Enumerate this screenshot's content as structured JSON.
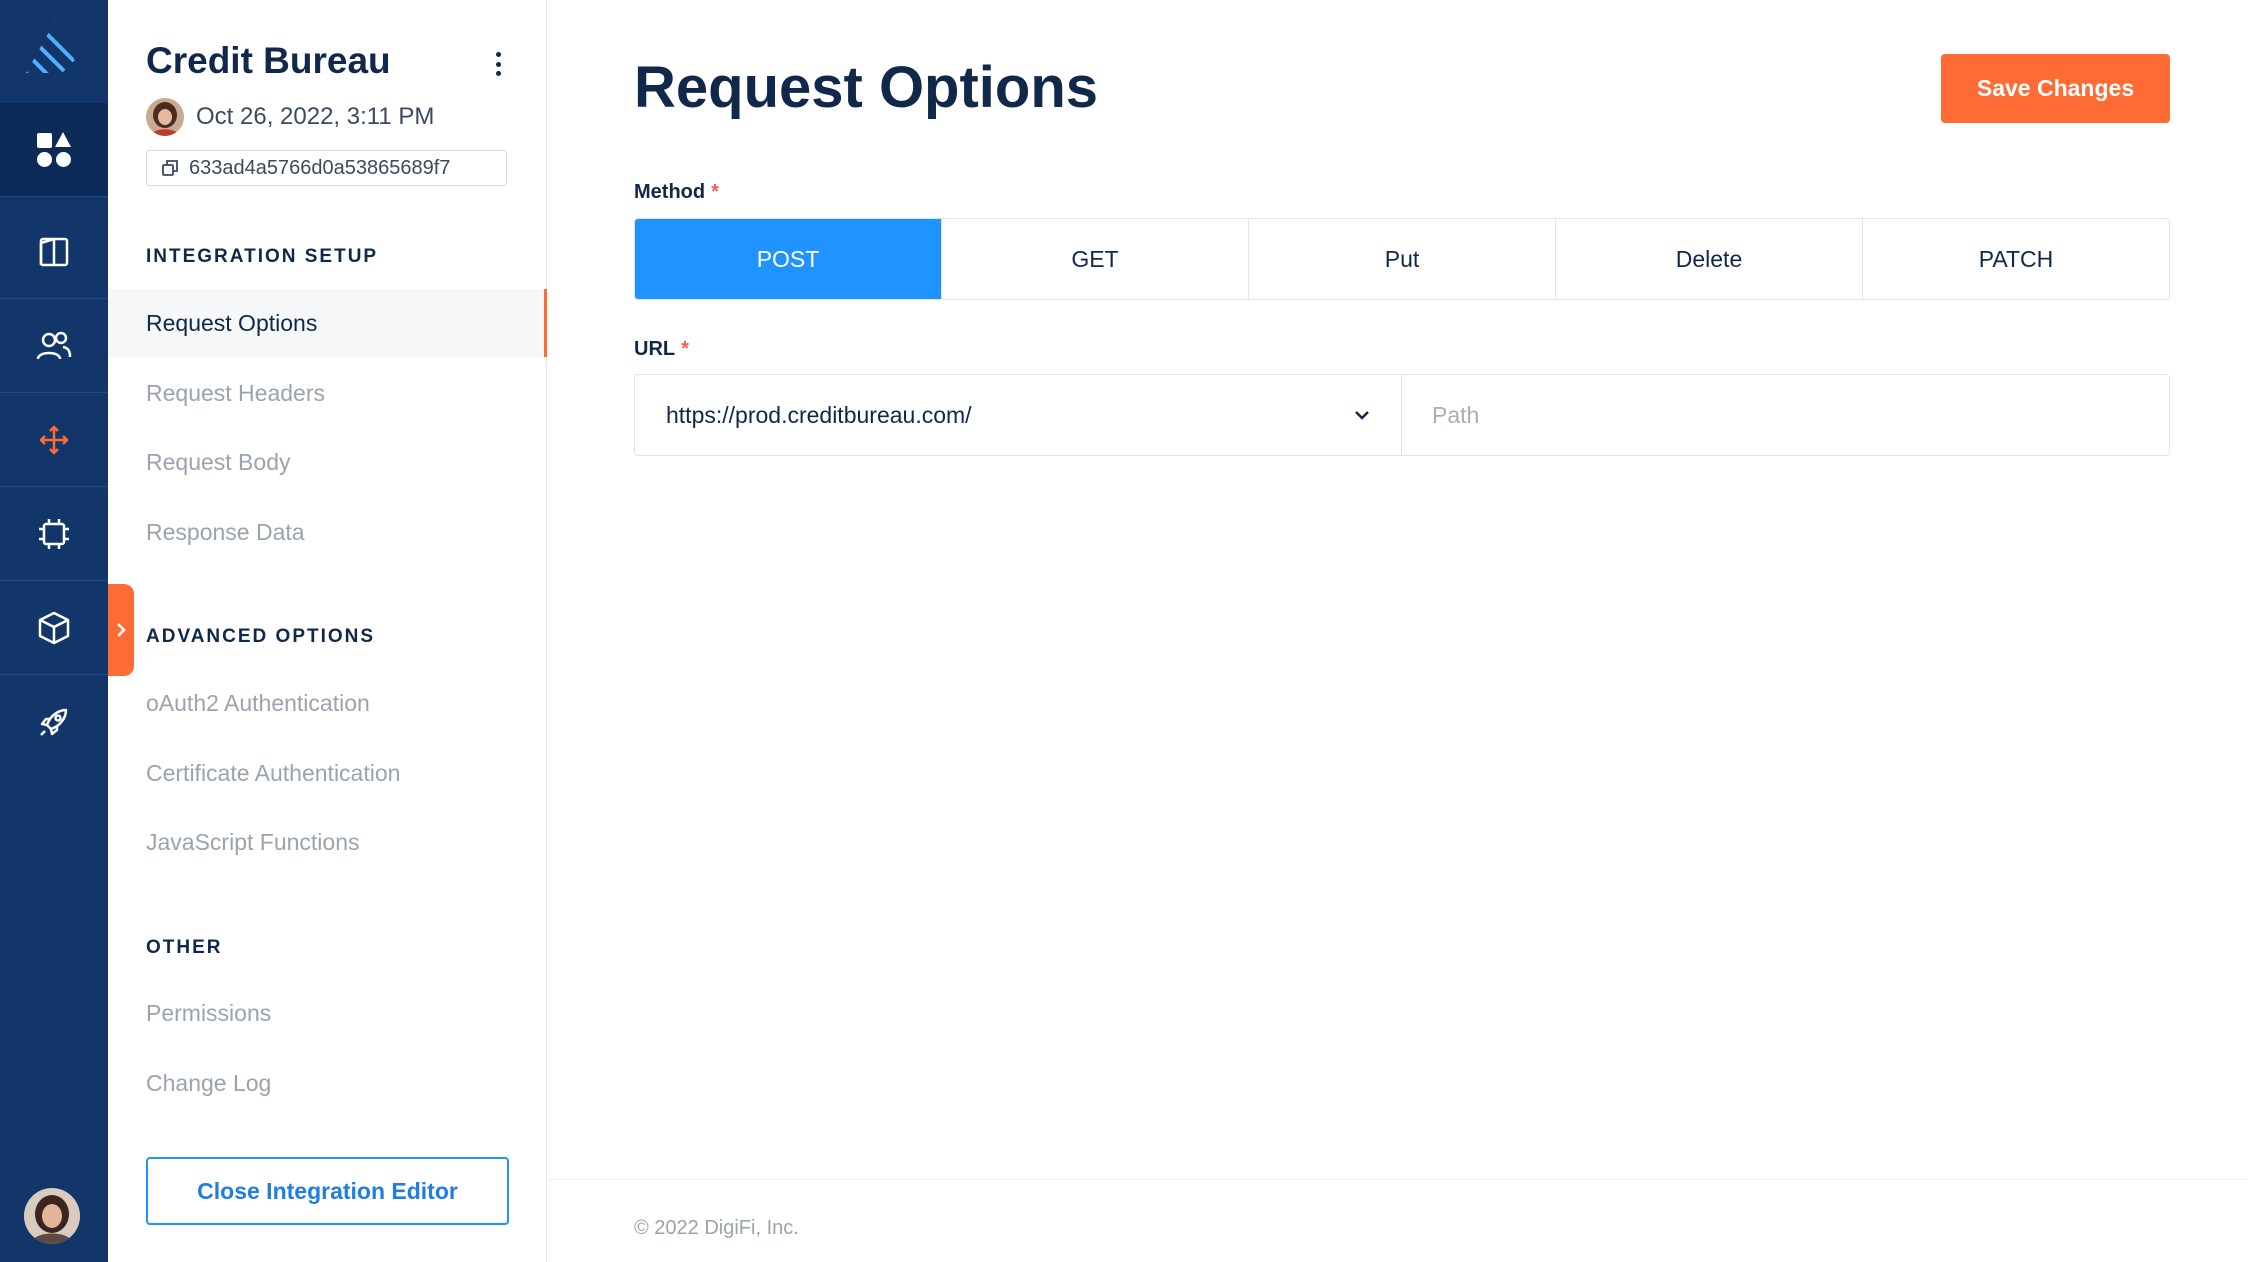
{
  "rail": {
    "items": [
      {
        "name": "apps-icon"
      },
      {
        "name": "book-icon"
      },
      {
        "name": "users-icon"
      },
      {
        "name": "integrations-icon"
      },
      {
        "name": "chip-icon"
      },
      {
        "name": "box-icon"
      },
      {
        "name": "rocket-icon"
      }
    ],
    "accent": "#ff6b35",
    "background": "#12356a"
  },
  "sidebar": {
    "title": "Credit Bureau",
    "date": "Oct 26, 2022, 3:11 PM",
    "id": "633ad4a5766d0a53865689f7",
    "sections": {
      "integration_setup": "INTEGRATION SETUP",
      "advanced_options": "ADVANCED OPTIONS",
      "other": "OTHER"
    },
    "items": {
      "request_options": "Request Options",
      "request_headers": "Request Headers",
      "request_body": "Request Body",
      "response_data": "Response Data",
      "oauth2": "oAuth2 Authentication",
      "certificate": "Certificate Authentication",
      "javascript": "JavaScript Functions",
      "permissions": "Permissions",
      "change_log": "Change Log"
    },
    "close_button": "Close Integration Editor"
  },
  "main": {
    "title": "Request Options",
    "save_button": "Save Changes",
    "method_label": "Method",
    "required_mark": "*",
    "methods": [
      "POST",
      "GET",
      "Put",
      "Delete",
      "PATCH"
    ],
    "selected_method": "POST",
    "url_label": "URL",
    "url_base": "https://prod.creditbureau.com/",
    "path_placeholder": "Path",
    "path_value": ""
  },
  "footer": {
    "text": "© 2022 DigiFi, Inc."
  },
  "colors": {
    "primary": "#1f93ff",
    "accent": "#ff6b35",
    "navy": "#12356a",
    "text": "#10284a"
  }
}
